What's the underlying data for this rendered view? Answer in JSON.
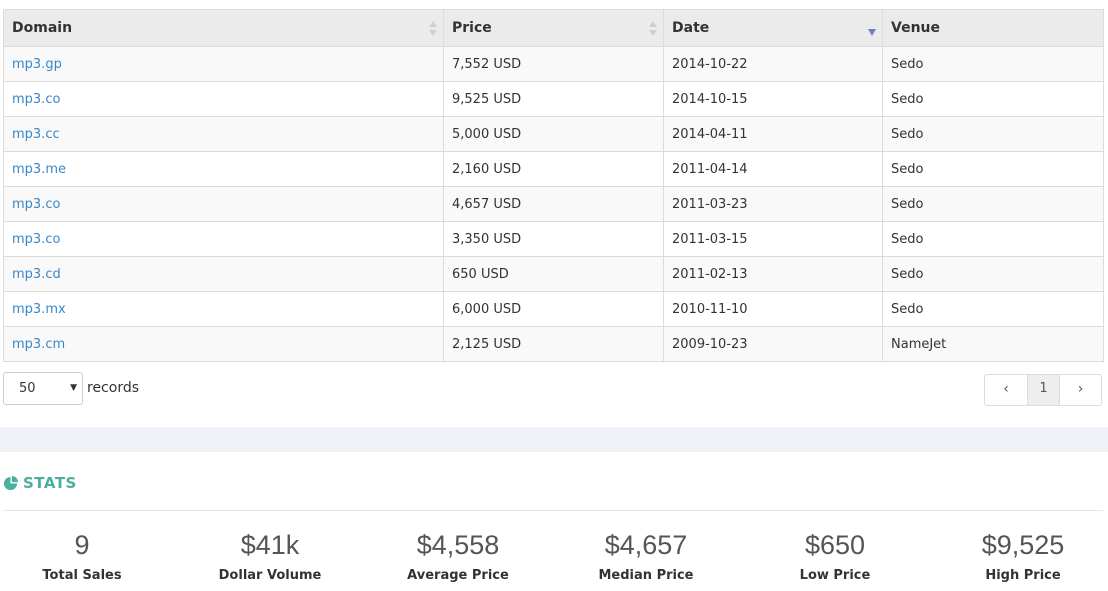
{
  "table": {
    "columns": [
      "Domain",
      "Price",
      "Date",
      "Venue"
    ],
    "rows": [
      {
        "domain": "mp3.gp",
        "price": "7,552 USD",
        "date": "2014-10-22",
        "venue": "Sedo"
      },
      {
        "domain": "mp3.co",
        "price": "9,525 USD",
        "date": "2014-10-15",
        "venue": "Sedo"
      },
      {
        "domain": "mp3.cc",
        "price": "5,000 USD",
        "date": "2014-04-11",
        "venue": "Sedo"
      },
      {
        "domain": "mp3.me",
        "price": "2,160 USD",
        "date": "2011-04-14",
        "venue": "Sedo"
      },
      {
        "domain": "mp3.co",
        "price": "4,657 USD",
        "date": "2011-03-23",
        "venue": "Sedo"
      },
      {
        "domain": "mp3.co",
        "price": "3,350 USD",
        "date": "2011-03-15",
        "venue": "Sedo"
      },
      {
        "domain": "mp3.cd",
        "price": "650 USD",
        "date": "2011-02-13",
        "venue": "Sedo"
      },
      {
        "domain": "mp3.mx",
        "price": "6,000 USD",
        "date": "2010-11-10",
        "venue": "Sedo"
      },
      {
        "domain": "mp3.cm",
        "price": "2,125 USD",
        "date": "2009-10-23",
        "venue": "NameJet"
      }
    ]
  },
  "length": {
    "selected": "50",
    "caret": "▼",
    "label": "records"
  },
  "pagination": {
    "prev": "‹",
    "current": "1",
    "next": "›"
  },
  "stats": {
    "title": "STATS",
    "items": [
      {
        "value": "9",
        "label": "Total Sales"
      },
      {
        "value": "$41k",
        "label": "Dollar Volume"
      },
      {
        "value": "$4,558",
        "label": "Average Price"
      },
      {
        "value": "$4,657",
        "label": "Median Price"
      },
      {
        "value": "$650",
        "label": "Low Price"
      },
      {
        "value": "$9,525",
        "label": "High Price"
      }
    ]
  },
  "colors": {
    "link": "#3a87c9",
    "accent": "#4cae9c",
    "sort_active": "#6f7fbf"
  },
  "icons": {
    "stats": "pie-chart-icon",
    "sort": "sort-icon",
    "sort_desc": "sort-desc-icon"
  }
}
